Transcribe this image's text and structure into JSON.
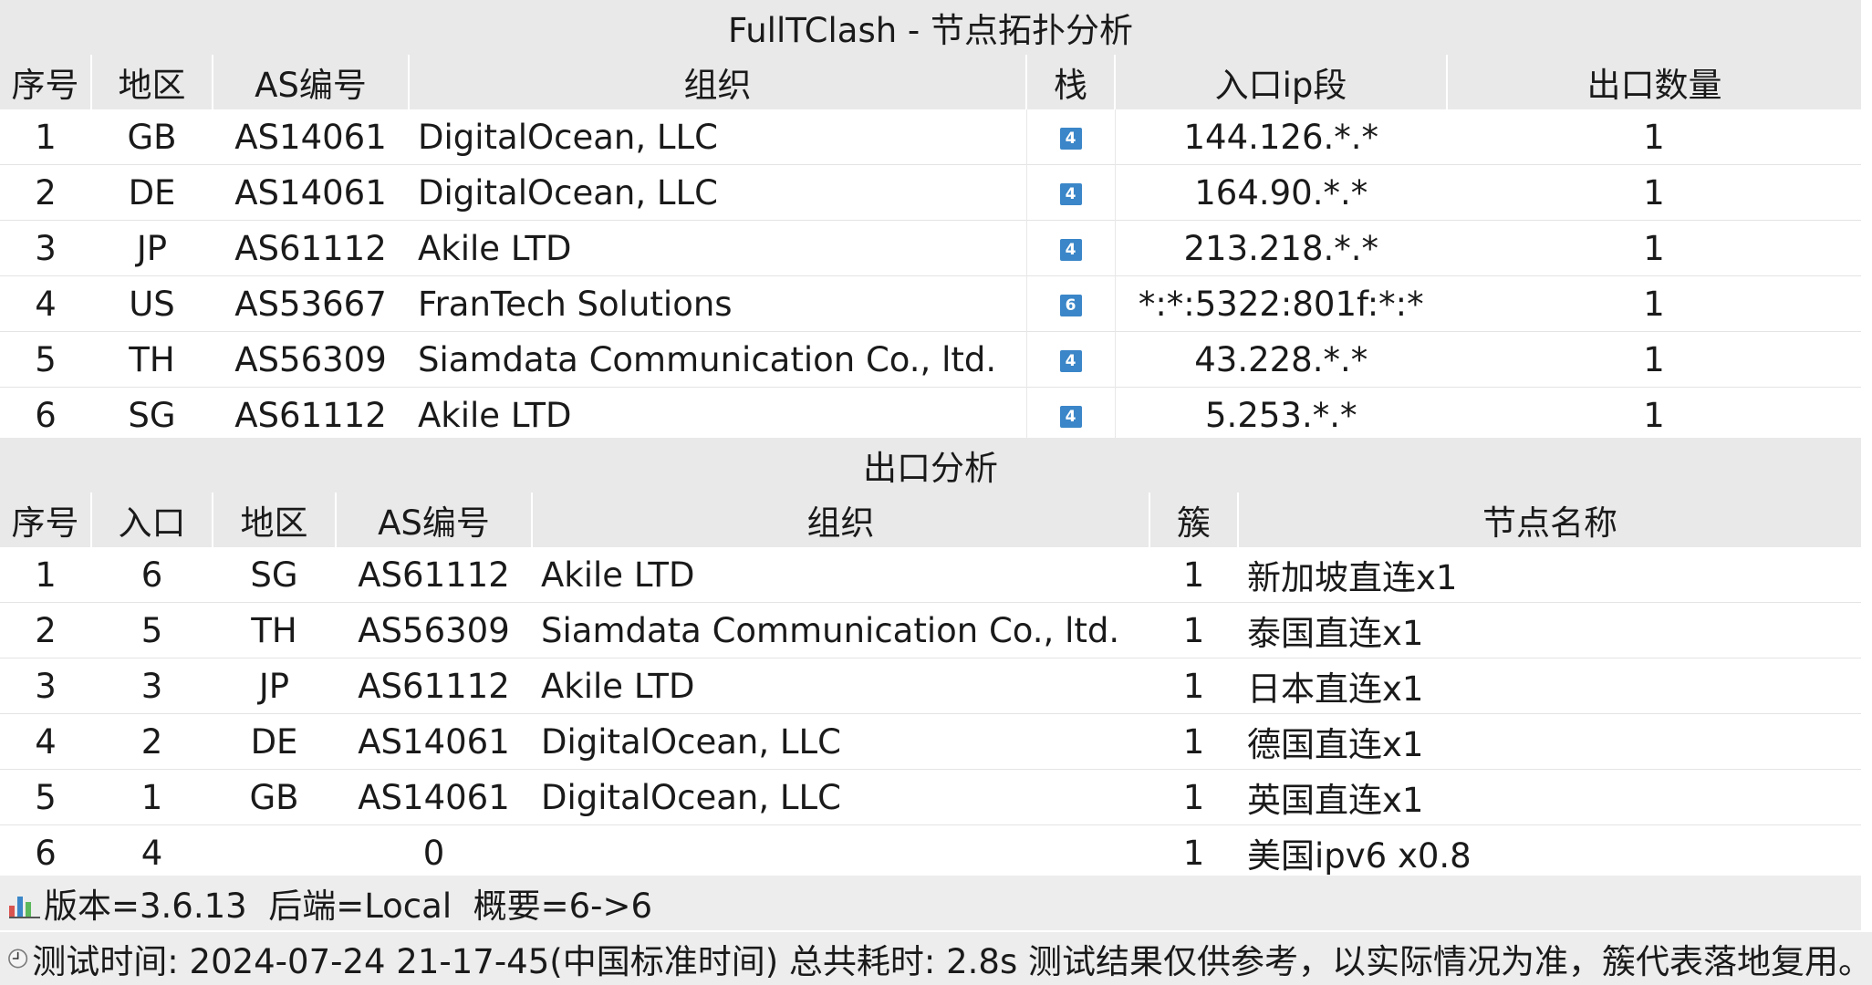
{
  "title": "FullTClash - 节点拓扑分析",
  "entry_table": {
    "headers": [
      "序号",
      "地区",
      "AS编号",
      "组织",
      "栈",
      "入口ip段",
      "出口数量"
    ],
    "rows": [
      {
        "idx": "1",
        "region": "GB",
        "asn": "AS14061",
        "org": "DigitalOcean, LLC",
        "stack": "4",
        "ip": "144.126.*.*",
        "exits": "1"
      },
      {
        "idx": "2",
        "region": "DE",
        "asn": "AS14061",
        "org": "DigitalOcean, LLC",
        "stack": "4",
        "ip": "164.90.*.*",
        "exits": "1"
      },
      {
        "idx": "3",
        "region": "JP",
        "asn": "AS61112",
        "org": "Akile LTD",
        "stack": "4",
        "ip": "213.218.*.*",
        "exits": "1"
      },
      {
        "idx": "4",
        "region": "US",
        "asn": "AS53667",
        "org": "FranTech Solutions",
        "stack": "6",
        "ip": "*:*:5322:801f:*:*",
        "exits": "1"
      },
      {
        "idx": "5",
        "region": "TH",
        "asn": "AS56309",
        "org": "Siamdata Communication Co., ltd.",
        "stack": "4",
        "ip": "43.228.*.*",
        "exits": "1"
      },
      {
        "idx": "6",
        "region": "SG",
        "asn": "AS61112",
        "org": "Akile LTD",
        "stack": "4",
        "ip": "5.253.*.*",
        "exits": "1"
      }
    ]
  },
  "exit_section_title": "出口分析",
  "exit_table": {
    "headers": [
      "序号",
      "入口",
      "地区",
      "AS编号",
      "组织",
      "簇",
      "节点名称"
    ],
    "rows": [
      {
        "idx": "1",
        "entry": "6",
        "region": "SG",
        "asn": "AS61112",
        "org": "Akile LTD",
        "cluster": "1",
        "name": "新加坡直连x1"
      },
      {
        "idx": "2",
        "entry": "5",
        "region": "TH",
        "asn": "AS56309",
        "org": "Siamdata Communication Co., ltd.",
        "cluster": "1",
        "name": "泰国直连x1"
      },
      {
        "idx": "3",
        "entry": "3",
        "region": "JP",
        "asn": "AS61112",
        "org": "Akile LTD",
        "cluster": "1",
        "name": "日本直连x1"
      },
      {
        "idx": "4",
        "entry": "2",
        "region": "DE",
        "asn": "AS14061",
        "org": "DigitalOcean, LLC",
        "cluster": "1",
        "name": "德国直连x1"
      },
      {
        "idx": "5",
        "entry": "1",
        "region": "GB",
        "asn": "AS14061",
        "org": "DigitalOcean, LLC",
        "cluster": "1",
        "name": "英国直连x1"
      },
      {
        "idx": "6",
        "entry": "4",
        "region": "",
        "asn": "0",
        "org": "",
        "cluster": "1",
        "name": "美国ipv6 x0.8"
      }
    ]
  },
  "footer": {
    "info_line": "版本=3.6.13  后端=Local  概要=6->6",
    "time_line": "测试时间: 2024-07-24 21-17-45(中国标准时间) 总共耗时: 2.8s 测试结果仅供参考，以实际情况为准，簇代表落地复用。",
    "chart_icon": "bar-chart-icon",
    "clock_icon": "clock-icon"
  },
  "colors": {
    "header_bg": "#e9e9e9",
    "stack_badge": "#3a86c8"
  }
}
